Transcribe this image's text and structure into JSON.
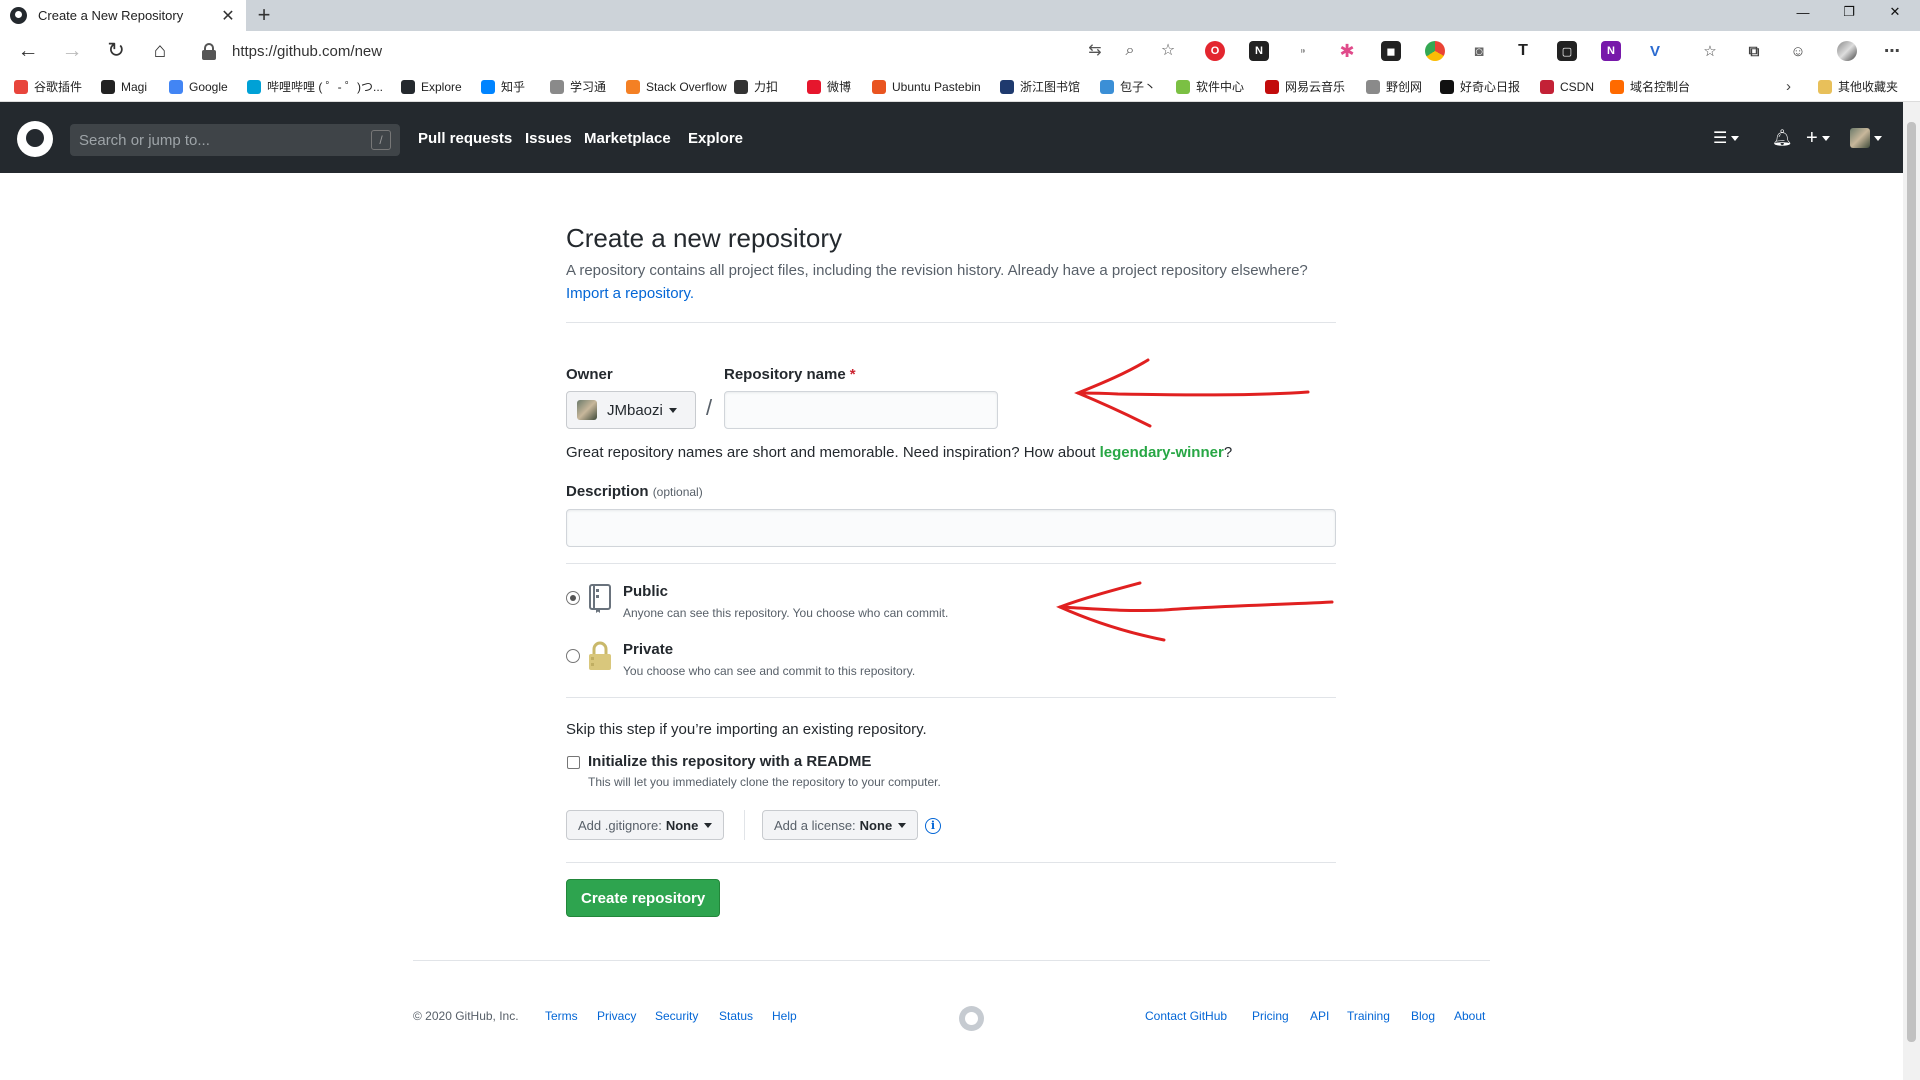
{
  "browser": {
    "tab_title": "Create a New Repository",
    "url": "https://github.com/new",
    "bookmarks": [
      {
        "label": "谷歌插件",
        "color": "#e8453c"
      },
      {
        "label": "Magi",
        "color": "#222222"
      },
      {
        "label": "Google",
        "color": "#4285f4"
      },
      {
        "label": "哔哩哔哩 ( ゜- ゜)つ...",
        "color": "#00a1d6"
      },
      {
        "label": "Explore",
        "color": "#24292e"
      },
      {
        "label": "知乎",
        "color": "#0084ff"
      },
      {
        "label": "学习通",
        "color": "#8a8a8a"
      },
      {
        "label": "Stack Overflow",
        "color": "#f48024"
      },
      {
        "label": "力扣",
        "color": "#333333"
      },
      {
        "label": "微博",
        "color": "#e6162d"
      },
      {
        "label": "Ubuntu Pastebin",
        "color": "#e95420"
      },
      {
        "label": "浙江图书馆",
        "color": "#1f3a6e"
      },
      {
        "label": "包子丶",
        "color": "#3b8fd6"
      },
      {
        "label": "软件中心",
        "color": "#7bc043"
      },
      {
        "label": "网易云音乐",
        "color": "#c20c0c"
      },
      {
        "label": "野创网",
        "color": "#8a8a8a"
      },
      {
        "label": "好奇心日报",
        "color": "#111111"
      },
      {
        "label": "CSDN",
        "color": "#c32136"
      },
      {
        "label": "域名控制台",
        "color": "#ff6a00"
      }
    ],
    "other_bookmarks": "其他收藏夹"
  },
  "header": {
    "search_placeholder": "Search or jump to...",
    "search_shortcut": "/",
    "nav": [
      "Pull requests",
      "Issues",
      "Marketplace",
      "Explore"
    ]
  },
  "page": {
    "title": "Create a new repository",
    "subtitle": "A repository contains all project files, including the revision history. Already have a project repository elsewhere?",
    "import_link": "Import a repository.",
    "owner_label": "Owner",
    "owner_value": "JMbaozi",
    "slash": "/",
    "repo_name_label": "Repository name",
    "required_mark": "*",
    "repo_name_value": "",
    "hint_prefix": "Great repository names are short and memorable. Need inspiration? How about ",
    "hint_suggestion": "legendary-winner",
    "hint_suffix": "?",
    "description_label": "Description",
    "description_optional": "(optional)",
    "description_value": "",
    "visibility": {
      "selected": "public",
      "public_title": "Public",
      "public_note": "Anyone can see this repository. You choose who can commit.",
      "private_title": "Private",
      "private_note": "You choose who can see and commit to this repository."
    },
    "skip_note": "Skip this step if you’re importing an existing repository.",
    "readme_label": "Initialize this repository with a README",
    "readme_note": "This will let you immediately clone the repository to your computer.",
    "readme_checked": false,
    "gitignore_prefix": "Add .gitignore:",
    "gitignore_value": "None",
    "license_prefix": "Add a license:",
    "license_value": "None",
    "info_icon": "i",
    "create_button": "Create repository"
  },
  "footer": {
    "copyright": "© 2020 GitHub, Inc.",
    "left_links": [
      "Terms",
      "Privacy",
      "Security",
      "Status",
      "Help"
    ],
    "right_links": [
      "Contact GitHub",
      "Pricing",
      "API",
      "Training",
      "Blog",
      "About"
    ]
  },
  "colors": {
    "header_bg": "#24292e",
    "create_button": "#2ea44f",
    "link": "#0366d6",
    "suggestion": "#28a745",
    "annotation_arrow": "#e02020"
  }
}
